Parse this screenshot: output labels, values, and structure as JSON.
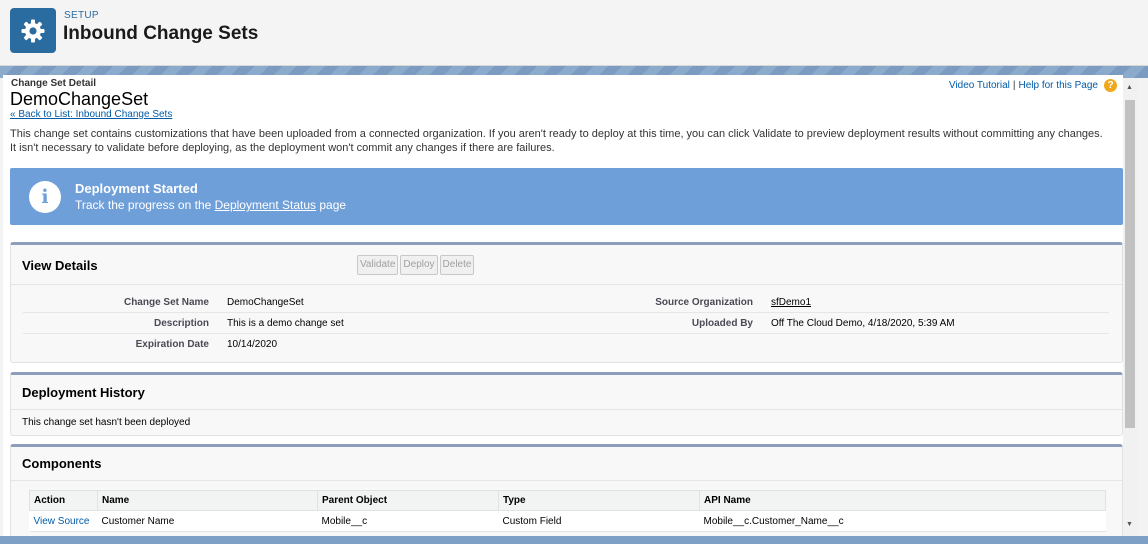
{
  "header": {
    "section_label": "SETUP",
    "title": "Inbound Change Sets",
    "icon": "gear-icon"
  },
  "page": {
    "breadcrumb_label": "Change Set Detail",
    "record_title": "DemoChangeSet",
    "back_link": "« Back to List: Inbound Change Sets",
    "help": {
      "video_tutorial": "Video Tutorial",
      "separator": "|",
      "help_for_page": "Help for this Page",
      "help_icon_glyph": "?"
    },
    "intro_text": "This change set contains customizations that have been uploaded from a connected organization. If you aren't ready to deploy at this time, you can click Validate to preview deployment results without committing any changes. It isn't necessary to validate before deploying, as the deployment won't commit any changes if there are failures."
  },
  "banner": {
    "icon_glyph": "i",
    "title": "Deployment Started",
    "text_prefix": "Track the progress on the ",
    "link": "Deployment Status",
    "text_suffix": " page",
    "color": "#6f9fd9"
  },
  "view_details": {
    "title": "View Details",
    "buttons": {
      "validate": "Validate",
      "deploy": "Deploy",
      "delete": "Delete"
    },
    "fields": {
      "change_set_name_label": "Change Set Name",
      "change_set_name": "DemoChangeSet",
      "description_label": "Description",
      "description": "This is a demo change set",
      "expiration_label": "Expiration Date",
      "expiration": "10/14/2020",
      "source_org_label": "Source Organization",
      "source_org": "sfDemo1",
      "uploaded_by_label": "Uploaded By",
      "uploaded_by": "Off The Cloud Demo, 4/18/2020, 5:39 AM"
    }
  },
  "deployment_history": {
    "title": "Deployment History",
    "empty_text": "This change set hasn't been deployed"
  },
  "components": {
    "title": "Components",
    "columns": {
      "action": "Action",
      "name": "Name",
      "parent": "Parent Object",
      "type": "Type",
      "api": "API Name"
    },
    "rows": [
      {
        "action": "View Source",
        "name": "Customer Name",
        "parent": "Mobile__c",
        "type": "Custom Field",
        "api": "Mobile__c.Customer_Name__c"
      }
    ]
  }
}
